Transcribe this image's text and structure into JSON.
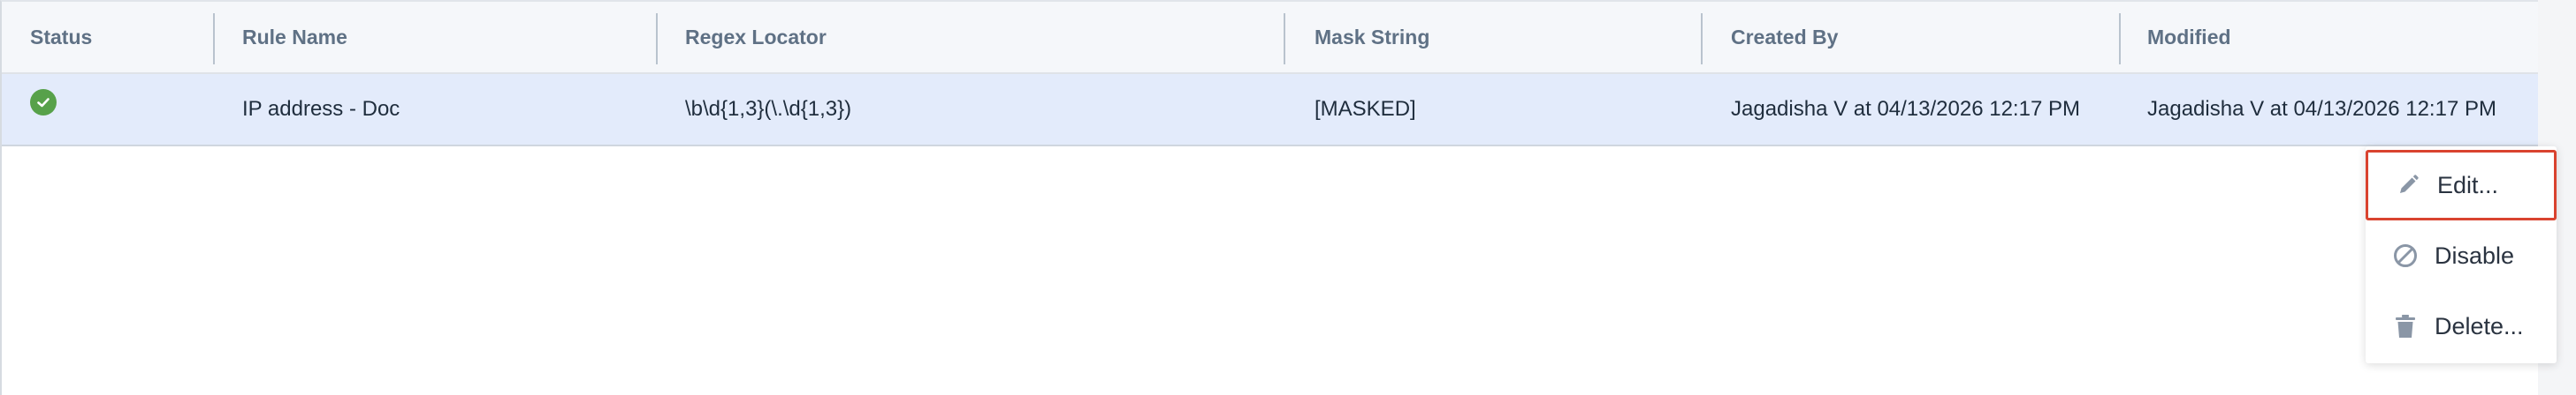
{
  "table": {
    "columns": {
      "status": "Status",
      "rule_name": "Rule Name",
      "regex_locator": "Regex Locator",
      "mask_string": "Mask String",
      "created_by": "Created By",
      "modified": "Modified"
    },
    "rows": [
      {
        "status": "enabled",
        "status_icon": "check-circle-icon",
        "rule_name": "IP address - Doc",
        "regex_locator": "\\b\\d{1,3}(\\.\\d{1,3})",
        "mask_string": "[MASKED]",
        "created_by": "Jagadisha V at 04/13/2026 12:17 PM",
        "modified": "Jagadisha V at 04/13/2026 12:17 PM"
      }
    ]
  },
  "context_menu": {
    "items": [
      {
        "label": "Edit...",
        "icon": "pencil-icon",
        "focused": true
      },
      {
        "label": "Disable",
        "icon": "disable-icon",
        "focused": false
      },
      {
        "label": "Delete...",
        "icon": "trash-icon",
        "focused": false
      }
    ]
  },
  "colors": {
    "selected_row": "#e3ebfb",
    "header_bg": "#f5f7fa",
    "status_ok": "#57a14a",
    "focus_outline": "#d9432f",
    "header_text": "#5f7185"
  }
}
